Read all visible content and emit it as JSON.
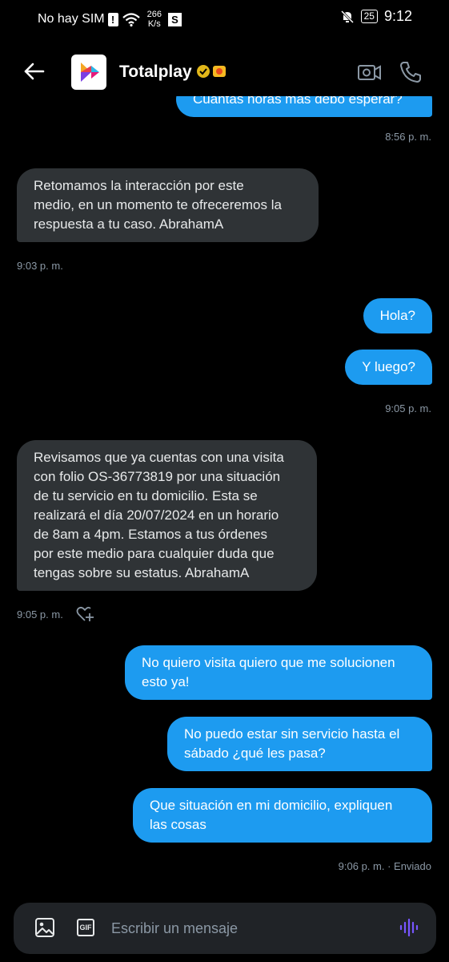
{
  "status_bar": {
    "carrier": "No hay SIM",
    "speed_value": "266",
    "speed_unit": "K/s",
    "s_badge": "S",
    "battery": "25",
    "time": "9:12"
  },
  "header": {
    "contact_name": "Totalplay",
    "icons": [
      "back-arrow-icon",
      "verified-badge-icon",
      "affiliate-badge-icon",
      "video-call-icon",
      "phone-icon"
    ]
  },
  "messages": [
    {
      "side": "out",
      "text": "Cuántas horas más debo esperar?"
    },
    {
      "type": "timestamp",
      "text": "8:56 p. m."
    },
    {
      "side": "in",
      "text": "Retomamos la interacción por este\nmedio, en un momento te ofreceremos la\nrespuesta a tu caso. AbrahamA"
    },
    {
      "type": "timestamp",
      "text": "9:03 p. m."
    },
    {
      "side": "out",
      "text": "Hola?"
    },
    {
      "side": "out",
      "text": "Y luego?"
    },
    {
      "type": "timestamp",
      "text": "9:05 p. m."
    },
    {
      "side": "in",
      "text": "Revisamos que ya cuentas con una visita\ncon folio OS-36773819 por una situación\nde tu servicio en tu domicilio. Esta se\nrealizará el día 20/07/2024 en un horario\nde 8am a 4pm. Estamos a tus órdenes\npor este medio para cualquier duda que\ntengas sobre su estatus. AbrahamA"
    },
    {
      "type": "timestamp",
      "text": "9:05 p. m."
    },
    {
      "side": "out",
      "text": "No quiero visita quiero que me solucionen\nesto ya!"
    },
    {
      "side": "out",
      "text": "No puedo estar sin servicio hasta el\nsábado ¿qué les pasa?"
    },
    {
      "side": "out",
      "text": "Que situación en mi domicilio, expliquen\nlas cosas"
    },
    {
      "type": "timestamp",
      "text": "9:06 p. m. · Enviado"
    }
  ],
  "composer": {
    "placeholder": "Escribir un mensaje",
    "gif_label": "GIF",
    "icons": [
      "image-icon",
      "gif-icon",
      "voice-message-icon"
    ]
  },
  "colors": {
    "background": "#000000",
    "outgoing_bubble": "#1d9bf0",
    "incoming_bubble": "#2f3336",
    "timestamp": "#8b98a5",
    "composer": "#202327",
    "voice_accent": "#7856ff"
  }
}
